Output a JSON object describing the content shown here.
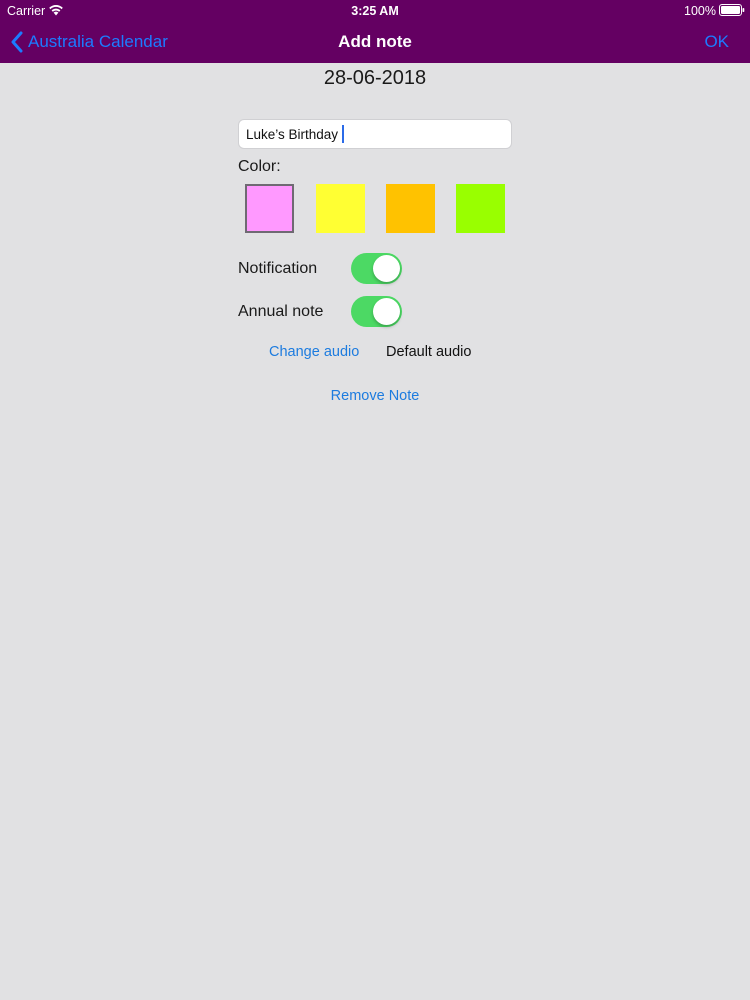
{
  "status_bar": {
    "carrier": "Carrier",
    "time": "3:25 AM",
    "battery": "100%"
  },
  "nav": {
    "back_label": "Australia Calendar",
    "title": "Add note",
    "ok_label": "OK"
  },
  "date": "28-06-2018",
  "note": {
    "value": "Luke’s Birthday"
  },
  "color": {
    "label": "Color:",
    "options": [
      {
        "name": "pink",
        "hex": "#ff99ff",
        "selected": true
      },
      {
        "name": "yellow",
        "hex": "#ffff33",
        "selected": false
      },
      {
        "name": "orange",
        "hex": "#ffc200",
        "selected": false
      },
      {
        "name": "green",
        "hex": "#99ff00",
        "selected": false
      }
    ]
  },
  "notification": {
    "label": "Notification",
    "on": true
  },
  "annual": {
    "label": "Annual note",
    "on": true
  },
  "audio": {
    "change_label": "Change audio",
    "current": "Default audio"
  },
  "remove_label": "Remove Note",
  "colors": {
    "nav_bar": "#640062",
    "background": "#e1e1e3",
    "link": "#1c7bff",
    "toggle_on": "#4cd964"
  },
  "icons": {
    "wifi": "wifi-icon",
    "battery": "battery-icon",
    "back": "chevron-left-icon"
  }
}
